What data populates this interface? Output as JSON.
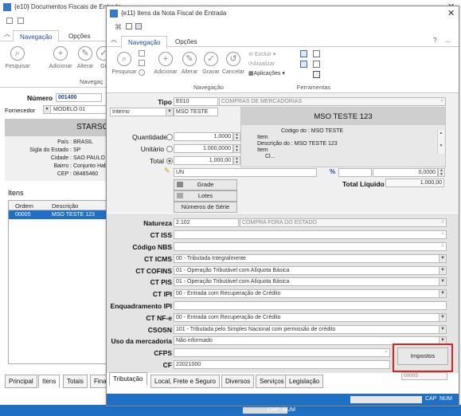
{
  "back": {
    "title": "{e10} Documentos Fiscais de Entrada",
    "ribbon_tabs": [
      "Navegação",
      "Opções"
    ],
    "buttons": [
      "Pesquisar",
      "Adicionar",
      "Alterar",
      "Gr"
    ],
    "group": "Navegaç",
    "numero_label": "Número",
    "numero_value": "001400",
    "fornecedor_label": "Fornecedor",
    "fornecedor_value": "MODELO 01",
    "company": "STARSOFT INDU",
    "info_rows": [
      {
        "label": "País :",
        "value": "BRASIL"
      },
      {
        "label": "Sigla do Estado :",
        "value": "SP"
      },
      {
        "label": "Cidade :",
        "value": "SAO PAULO"
      },
      {
        "label": "Bairro :",
        "value": "Conjunto Hab"
      },
      {
        "label": "CEP :",
        "value": "08485460"
      }
    ],
    "itens_label": "Itens",
    "grid_headers": [
      "Ordem",
      "Descrição"
    ],
    "grid_row": {
      "ordem": "00005",
      "descricao": "MSO TESTE 123"
    },
    "bottom_tabs": [
      "Principal",
      "Itens",
      "Totais",
      "Finan"
    ],
    "status": [
      "CAP",
      "NUM"
    ]
  },
  "front": {
    "title": "{e11} Itens da Nota Fiscal de Entrada",
    "ribbon_tabs": [
      "Navegação",
      "Opções"
    ],
    "ribbon_right": [
      "?",
      "..."
    ],
    "buttons": [
      "Pesquisar",
      "Adicionar",
      "Alterar",
      "Gravar",
      "Cancelar"
    ],
    "small_buttons": [
      "Excluir",
      "Atualizar",
      "Aplicações"
    ],
    "groups": [
      "Navegação",
      "Ferramentas"
    ],
    "tipo_label": "Tipo",
    "tipo_value": "E010",
    "tipo_desc": "COMPRAS DE MERCADORIAS",
    "interno_value": "Interno",
    "produto_value": "MSO TESTE",
    "produto_title": "MSO TESTE 123",
    "produto_info": [
      "Código do : MSO TESTE",
      "Item",
      "Descrição do : MSO TESTE 123",
      "Item",
      "Cl..."
    ],
    "qtd_label": "Quantidade",
    "qtd_value": "1,0000",
    "unit_label": "Unitário",
    "unit_value": "1.000,0000",
    "total_label": "Total",
    "total_value": "1.000,00",
    "un_value": "UN",
    "pct_value": "0,0000",
    "total_liquido_label": "Total Líquido",
    "total_liquido_value": "1.000,00",
    "grade_btn": "Grade",
    "lotes_btn": "Lotes",
    "series_btn": "Números de Série",
    "natureza_label": "Natureza",
    "natureza_value": "2.102",
    "natureza_desc": "COMPRA FORA DO ESTADO",
    "ctiss_label": "CT ISS",
    "nbs_label": "Código NBS",
    "tax_rows": [
      {
        "label": "CT ICMS",
        "value": "00 - Tributada Integralmente"
      },
      {
        "label": "CT COFINS",
        "value": "01 - Operação Tributável com Alíquota Básica"
      },
      {
        "label": "CT PIS",
        "value": "01 - Operação Tributável com Alíquota Básica"
      },
      {
        "label": "CT IPI",
        "value": "00 - Entrada com Recuperação de Crédito"
      },
      {
        "label": "Enquadramento IPI",
        "value": ""
      },
      {
        "label": "CT NF-e",
        "value": "00 - Entrada com Recuperação de Crédito"
      },
      {
        "label": "CSOSN",
        "value": "101 - Tributada pelo Simples Nacional com permissão de crédito"
      },
      {
        "label": "Uso da mercadoria",
        "value": "Não informado"
      }
    ],
    "cfps_label": "CFPS",
    "cf_label": "CF",
    "cf_value": "22021000",
    "impostos_btn": "Impostos",
    "order_value": "00005",
    "tabs": [
      "Tributação",
      "Local, Frete e Seguro",
      "Diversos",
      "Serviços",
      "Legislação"
    ],
    "status": [
      "CAP",
      "NUM"
    ],
    "highlight_color": "#e02020"
  }
}
